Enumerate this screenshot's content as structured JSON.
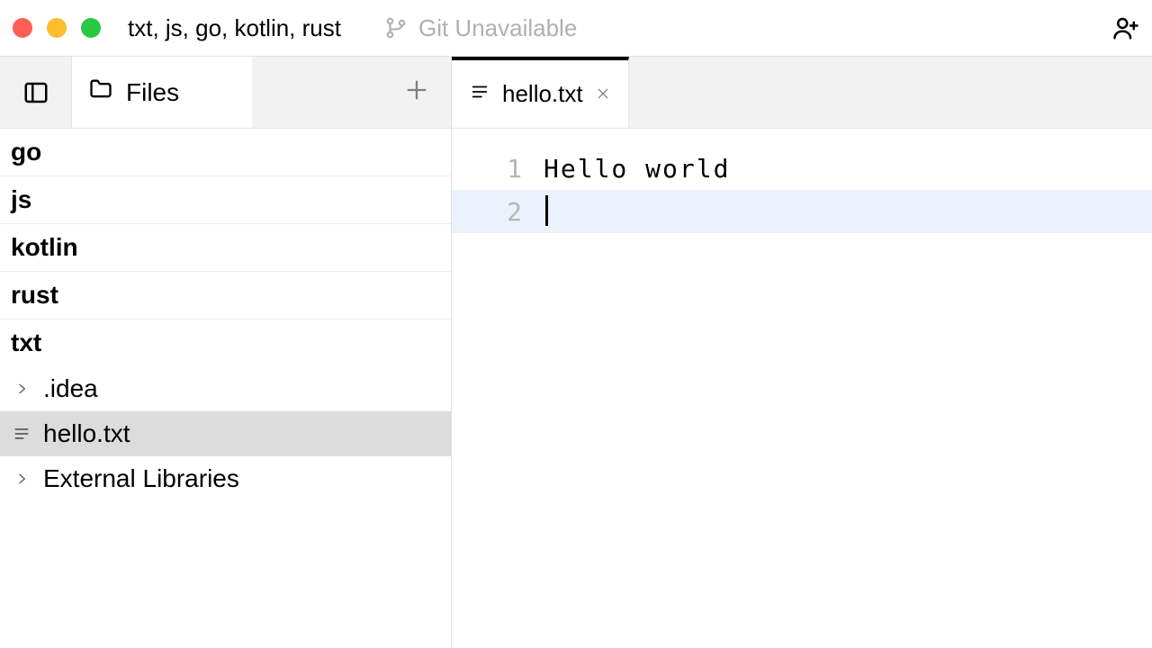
{
  "titlebar": {
    "project_name": "txt, js, go, kotlin, rust",
    "git_status": "Git Unavailable"
  },
  "sidebar": {
    "tab_label": "Files",
    "roots": [
      "go",
      "js",
      "kotlin",
      "rust",
      "txt"
    ],
    "txt_children": [
      {
        "label": ".idea",
        "icon": "chevron",
        "selected": false
      },
      {
        "label": "hello.txt",
        "icon": "lines",
        "selected": true
      },
      {
        "label": "External Libraries",
        "icon": "chevron",
        "selected": false
      }
    ]
  },
  "editor": {
    "tab_filename": "hello.txt",
    "lines": [
      {
        "n": "1",
        "text": "Hello world",
        "current": false
      },
      {
        "n": "2",
        "text": "",
        "current": true
      }
    ]
  }
}
